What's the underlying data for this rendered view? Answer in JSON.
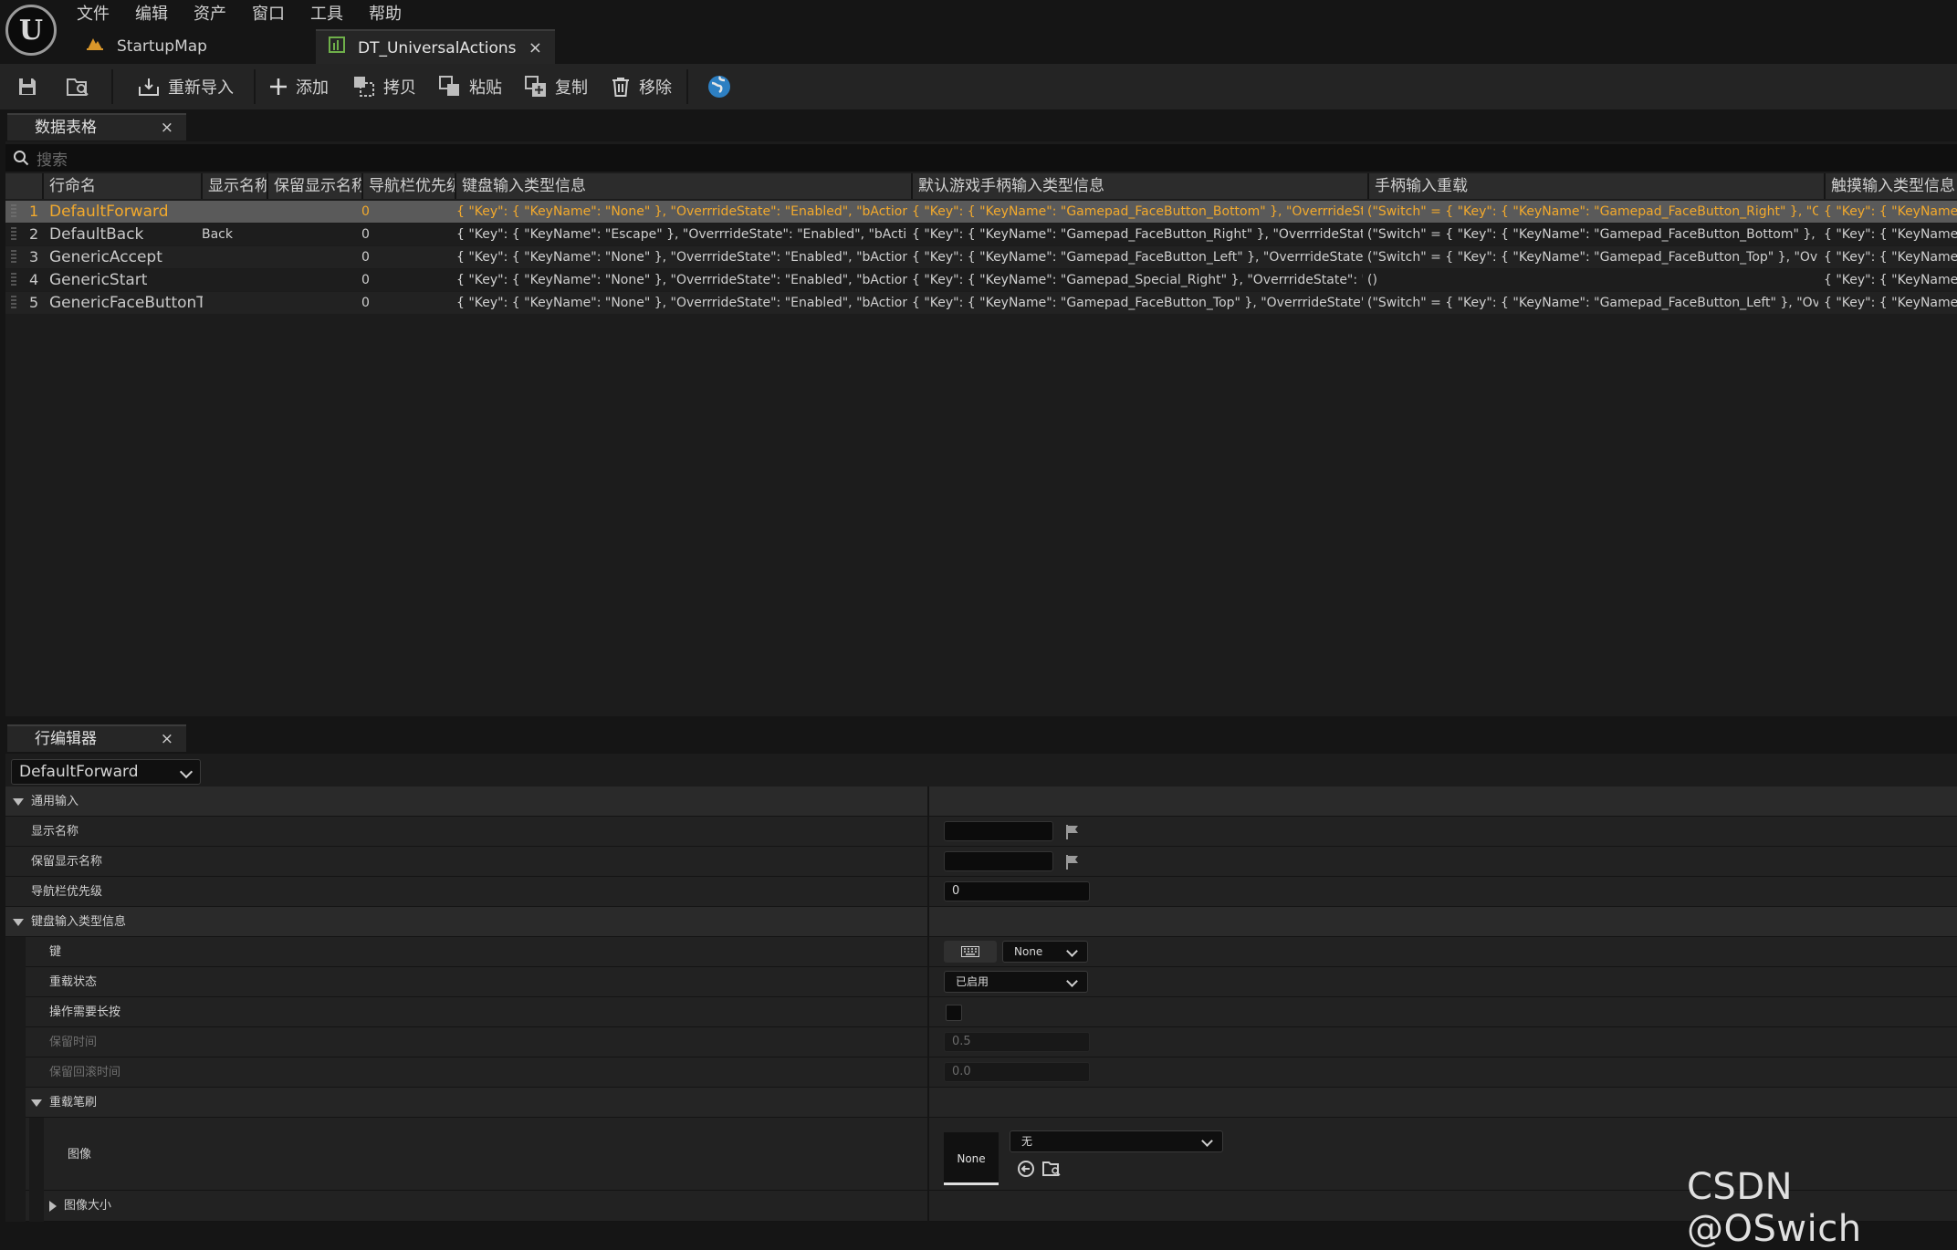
{
  "menu": [
    "文件",
    "编辑",
    "资产",
    "窗口",
    "工具",
    "帮助"
  ],
  "tabs": [
    {
      "label": "StartupMap"
    },
    {
      "label": "DT_UniversalActions",
      "close": "×"
    }
  ],
  "toolbar": {
    "reimport": "重新导入",
    "add": "添加",
    "copy": "拷贝",
    "paste": "粘贴",
    "duplicate": "复制",
    "remove": "移除"
  },
  "datatable_panel": {
    "title": "数据表格",
    "close": "×",
    "search_placeholder": "搜索"
  },
  "columns": [
    "行命名",
    "显示名称",
    "保留显示名称",
    "导航栏优先级",
    "键盘输入类型信息",
    "默认游戏手柄输入类型信息",
    "手柄输入重载",
    "触摸输入类型信息"
  ],
  "rows": [
    {
      "index": "1",
      "name": "DefaultForward",
      "display": "",
      "priority": "0",
      "keyboard": "{ \"Key\": { \"KeyName\": \"None\" }, \"OverrrideState\": \"Enabled\", \"bActionRequ",
      "gamepad": "{ \"Key\": { \"KeyName\": \"Gamepad_FaceButton_Bottom\" }, \"OverrrideState\":",
      "override": "(\"Switch\" = { \"Key\": { \"KeyName\": \"Gamepad_FaceButton_Right\" }, \"Overr",
      "touch": "{ \"Key\": { \"KeyName\":"
    },
    {
      "index": "2",
      "name": "DefaultBack",
      "display": "Back",
      "priority": "0",
      "keyboard": "{ \"Key\": { \"KeyName\": \"Escape\" }, \"OverrrideState\": \"Enabled\", \"bActionRec",
      "gamepad": "{ \"Key\": { \"KeyName\": \"Gamepad_FaceButton_Right\" }, \"OverrrideState\": \"I",
      "override": "(\"Switch\" = { \"Key\": { \"KeyName\": \"Gamepad_FaceButton_Bottom\" }, \"Ove",
      "touch": "{ \"Key\": { \"KeyName\":"
    },
    {
      "index": "3",
      "name": "GenericAccept",
      "display": "",
      "priority": "0",
      "keyboard": "{ \"Key\": { \"KeyName\": \"None\" }, \"OverrrideState\": \"Enabled\", \"bActionRequ",
      "gamepad": "{ \"Key\": { \"KeyName\": \"Gamepad_FaceButton_Left\" }, \"OverrrideState\": \"Er",
      "override": "(\"Switch\" = { \"Key\": { \"KeyName\": \"Gamepad_FaceButton_Top\" }, \"Overric",
      "touch": "{ \"Key\": { \"KeyName\":"
    },
    {
      "index": "4",
      "name": "GenericStart",
      "display": "",
      "priority": "0",
      "keyboard": "{ \"Key\": { \"KeyName\": \"None\" }, \"OverrrideState\": \"Enabled\", \"bActionRequ",
      "gamepad": "{ \"Key\": { \"KeyName\": \"Gamepad_Special_Right\" }, \"OverrrideState\": \"Enab",
      "override": "()",
      "touch": "{ \"Key\": { \"KeyName\":"
    },
    {
      "index": "5",
      "name": "GenericFaceButtonT",
      "display": "",
      "priority": "0",
      "keyboard": "{ \"Key\": { \"KeyName\": \"None\" }, \"OverrrideState\": \"Enabled\", \"bActionRequ",
      "gamepad": "{ \"Key\": { \"KeyName\": \"Gamepad_FaceButton_Top\" }, \"OverrrideState\": \"Er",
      "override": "(\"Switch\" = { \"Key\": { \"KeyName\": \"Gamepad_FaceButton_Left\" }, \"Overrid",
      "touch": "{ \"Key\": { \"KeyName\":"
    }
  ],
  "row_editor": {
    "title": "行编辑器",
    "close": "×",
    "selected_row": "DefaultForward",
    "cat_general": "通用输入",
    "display_name": "显示名称",
    "display_value": "",
    "keep_display": "保留显示名称",
    "keep_value": "",
    "nav_priority": "导航栏优先级",
    "nav_value": "0",
    "cat_keyboard": "键盘输入类型信息",
    "key": "键",
    "key_value": "None",
    "override_state": "重载状态",
    "override_value": "已启用",
    "hold_required": "操作需要长按",
    "hold_time": "保留时间",
    "hold_time_value": "0.5",
    "hold_rollback": "保留回滚时间",
    "hold_rollback_value": "0.0",
    "cat_brush": "重载笔刷",
    "image": "图像",
    "image_thumb": "None",
    "image_value": "无",
    "image_size": "图像大小"
  },
  "watermark": "CSDN @OSwich",
  "colors": {
    "selected_text": "#f2a92c",
    "bg": "#151515",
    "panel": "#1c1c1c"
  }
}
